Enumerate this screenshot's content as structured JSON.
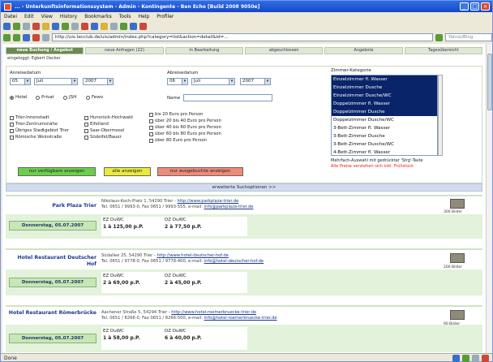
{
  "window": {
    "title": "... - Unterkunftsinformationssystem - Admin - Kontingente - Ben Echo [Build 2008 9050e]",
    "controls": [
      "_",
      "□",
      "×"
    ]
  },
  "menu": [
    "Datei",
    "Edit",
    "View",
    "History",
    "Bookmarks",
    "Tools",
    "Help",
    "Profiler"
  ],
  "address": {
    "url": "http://uis.tecclub.de/uis/admin/index.php?category=list&action=detail&id=...",
    "search_placeholder": "Yahoo/Bing"
  },
  "tabs": [
    "neue Buchung / Angebot",
    "neue Anfragen (22)",
    "in Bearbeitung",
    "abgeschlossen",
    "Angebote",
    "Tagesübersicht"
  ],
  "logged_in": "eingeloggt: Egbert Decker",
  "form": {
    "arrival_label": "Anreisedatum",
    "departure_label": "Abreisedatum",
    "arrival": {
      "day": "05",
      "month": "Juli",
      "year": "2007"
    },
    "departure": {
      "day": "06",
      "month": "Juli",
      "year": "2007"
    },
    "types": [
      {
        "label": "Hotel",
        "checked": true
      },
      {
        "label": "Privat",
        "checked": false
      },
      {
        "label": "JSH",
        "checked": false
      },
      {
        "label": "Fewo",
        "checked": false
      }
    ],
    "name_label": "Name",
    "features_col1": [
      "Trier-Innenstadt",
      "Trier-Zentrumsnähe",
      "Übriges Stadtgebiet Trier",
      "Römische Weinstraße"
    ],
    "features_col2": [
      "Hunsrück-Hochwald",
      "Eifelland",
      "Saar-Obermosel",
      "Südeifel/Bauer"
    ],
    "price_options": [
      "bis 20 Euro pro Person",
      "über 20 bis 40 Euro pro Person",
      "über 40 bis 60 Euro pro Person",
      "über 60 bis 80 Euro pro Person",
      "über 80 Euro pro Person"
    ],
    "room_category_label": "Zimmer-Kategorie",
    "room_categories": [
      {
        "label": "Einzelzimmer fl. Wasser",
        "selected": true
      },
      {
        "label": "Einzelzimmer Dusche",
        "selected": true
      },
      {
        "label": "Einzelzimmer Dusche/WC",
        "selected": true
      },
      {
        "label": "Doppelzimmer fl. Wasser",
        "selected": true
      },
      {
        "label": "Doppelzimmer Dusche",
        "selected": true
      },
      {
        "label": "Doppelzimmer Dusche/WC",
        "selected": false
      },
      {
        "label": "3-Bett-Zimmer fl. Wasser",
        "selected": false
      },
      {
        "label": "3-Bett-Zimmer Dusche",
        "selected": false
      },
      {
        "label": "3-Bett-Zimmer Dusche/WC",
        "selected": false
      },
      {
        "label": "4-Bett-Zimmer fl. Wasser",
        "selected": false
      }
    ],
    "note_multi": "Mehrfach-Auswahl mit gedrückter 'Strg'-Taste",
    "note_prices": "Alle Preise verstehen sich inkl. Frühstück",
    "btn_available": "nur verfügbare anzeigen",
    "btn_all": "alle anzeigen",
    "btn_booked": "nur ausgebuchte anzeigen"
  },
  "extended_search": "erweiterte Suchoptionen >>",
  "hotels": [
    {
      "name": "Park Plaza Trier",
      "address": "Nikolaus-Koch-Platz 1, 54290 Trier",
      "web": "http://www.parkplaza-trier.de",
      "contact": "Tel. 0651 / 9993-0, Fax 0651 / 9993-555, e-mail:",
      "email": "info@parkplaza-trier.de",
      "date": "Donnerstag, 05.07.2007",
      "offers": [
        {
          "type": "EZ DuWC",
          "price": "1 à 125,00 p.P."
        },
        {
          "type": "DZ DuWC",
          "price": "2 à 77,50 p.P."
        }
      ],
      "thumb_label": "300 Bilder"
    },
    {
      "name": "Hotel Restaurant Deutscher Hof",
      "address": "Südallee 25, 54290 Trier",
      "web": "http://www.hotel-deutscher-hof.de",
      "contact": "Tel. 0651 / 9778-0, Fax 0651 / 9778-400, e-mail:",
      "email": "info@hotel-deutscher-hof.de",
      "date": "Donnerstag, 05.07.2007",
      "offers": [
        {
          "type": "EZ DuWC",
          "price": "2 à 69,00 p.P."
        },
        {
          "type": "DZ DuWC",
          "price": "2 à 45,00 p.P."
        }
      ],
      "thumb_label": "200 Bilder"
    },
    {
      "name": "Hotel Restaurant Römerbrücke",
      "address": "Aachener Straße 5, 54294 Trier",
      "web": "http://www.hotel-roemerbruecke-trier.de",
      "contact": "Tel. 0651 / 8266-0, Fax 0651 / 8266-500, e-mail:",
      "email": "info@hotel-roemerbruecke-trier.de",
      "date": "Donnerstag, 05.07.2007",
      "offers": [
        {
          "type": "EZ DuWC",
          "price": "1 à 58,00 p.P."
        },
        {
          "type": "DZ DuWC",
          "price": "6 à 40,00 p.P."
        }
      ],
      "thumb_label": "90 Bilder"
    }
  ],
  "status": "Done"
}
